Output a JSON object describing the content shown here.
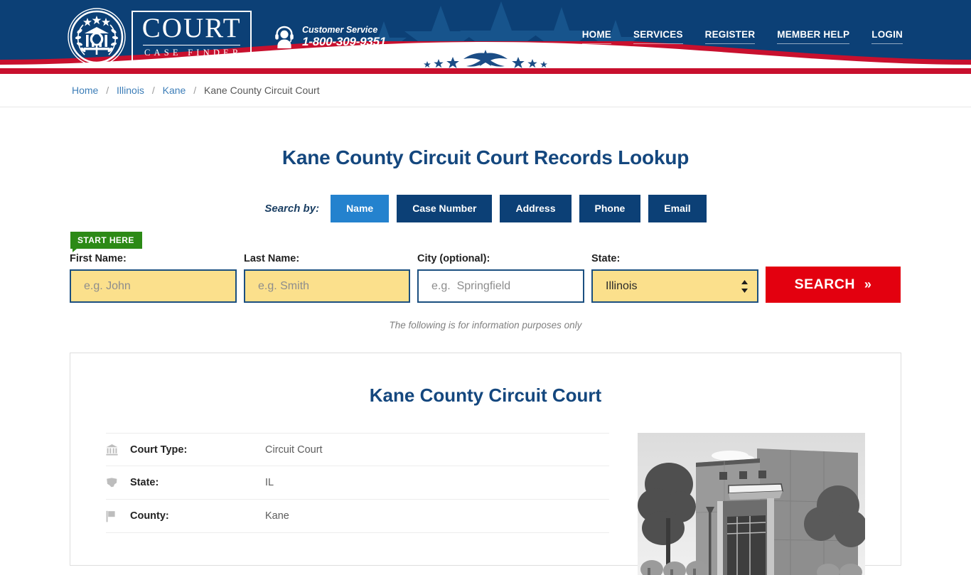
{
  "header": {
    "logo": {
      "main": "COURT",
      "sub": "CASE FINDER",
      "seal_icon": "court-seal-icon"
    },
    "customer_service": {
      "icon": "headset-support-icon",
      "label": "Customer Service",
      "phone": "1-800-309-9351"
    },
    "nav": [
      {
        "label": "HOME",
        "name": "nav-home"
      },
      {
        "label": "SERVICES",
        "name": "nav-services"
      },
      {
        "label": "REGISTER",
        "name": "nav-register"
      },
      {
        "label": "MEMBER HELP",
        "name": "nav-member-help"
      },
      {
        "label": "LOGIN",
        "name": "nav-login"
      }
    ],
    "colors": {
      "navy": "#0c4076",
      "red": "#c8102e",
      "white": "#ffffff"
    }
  },
  "breadcrumb": {
    "items": [
      {
        "label": "Home",
        "link": true
      },
      {
        "label": "Illinois",
        "link": true
      },
      {
        "label": "Kane",
        "link": true
      },
      {
        "label": "Kane County Circuit Court",
        "link": false
      }
    ],
    "separator": "/"
  },
  "main": {
    "page_title": "Kane County Circuit Court Records Lookup",
    "search_by_label": "Search by:",
    "tabs": [
      {
        "label": "Name",
        "active": true
      },
      {
        "label": "Case Number",
        "active": false
      },
      {
        "label": "Address",
        "active": false
      },
      {
        "label": "Phone",
        "active": false
      },
      {
        "label": "Email",
        "active": false
      }
    ],
    "start_here_badge": "START HERE",
    "form": {
      "first_name": {
        "label": "First Name:",
        "placeholder": "e.g. John",
        "value": ""
      },
      "last_name": {
        "label": "Last Name:",
        "placeholder": "e.g. Smith",
        "value": ""
      },
      "city": {
        "label": "City (optional):",
        "placeholder": "e.g.  Springfield",
        "value": ""
      },
      "state": {
        "label": "State:",
        "selected": "Illinois"
      },
      "search_button": "SEARCH",
      "search_button_chevron": "»"
    },
    "disclaimer": "The following is for information purposes only"
  },
  "card": {
    "title": "Kane County Circuit Court",
    "rows": [
      {
        "icon": "bank-icon",
        "label": "Court Type:",
        "value": "Circuit Court"
      },
      {
        "icon": "state-shape-icon",
        "label": "State:",
        "value": "IL"
      },
      {
        "icon": "flag-icon",
        "label": "County:",
        "value": "Kane"
      }
    ],
    "photo_alt": "courthouse-building-photo"
  }
}
